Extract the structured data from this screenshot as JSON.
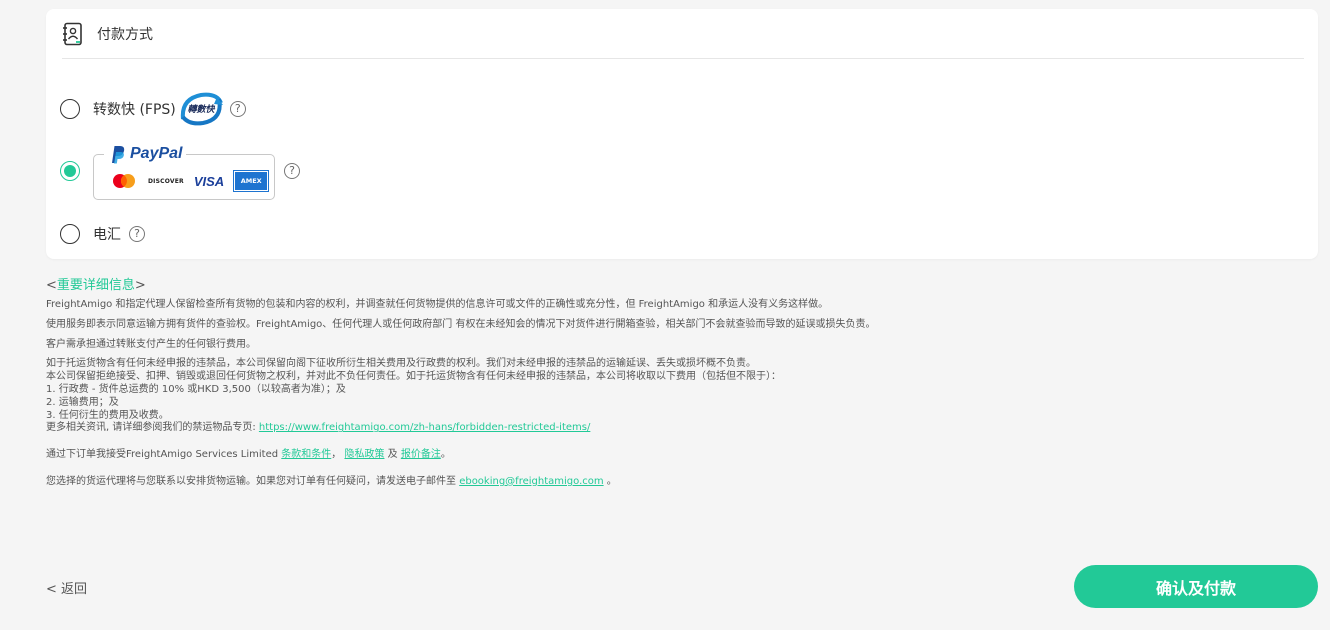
{
  "payment_card": {
    "title": "付款方式",
    "options": [
      {
        "label": "转数快 (FPS)",
        "logo_text": "轉數快",
        "selected": false
      },
      {
        "label": "",
        "brand": "PayPal",
        "card_brands": [
          "DISCOVER",
          "VISA",
          "AMEX"
        ],
        "selected": true
      },
      {
        "label": "电汇",
        "selected": false
      }
    ],
    "help_glyph": "?"
  },
  "info": {
    "heading_open": "<",
    "heading": "重要详细信息",
    "heading_close": ">",
    "p1": "FreightAmigo 和指定代理人保留检查所有货物的包装和内容的权利，并调查就任何货物提供的信息许可或文件的正确性或充分性，但 FreightAmigo 和承运人没有义务这样做。",
    "p2": "使用服务即表示同意运输方拥有货件的查验权。FreightAmigo、任何代理人或任何政府部门 有权在未经知会的情况下对货件进行開箱查验，相关部门不会就查验而导致的延误或损失负责。",
    "p3": "客户需承担通过转账支付产生的任何银行费用。",
    "p4_lines": [
      "如于托运货物含有任何未经申报的违禁品，本公司保留向阁下征收所衍生相关费用及行政费的权利。我们对未经申报的违禁品的运输延误、丢失或损坏概不负责。",
      "本公司保留拒绝接受、扣押、销毁或退回任何货物之权利，并对此不负任何责任。如于托运货物含有任何未经申报的违禁品，本公司将收取以下费用（包括但不限于）：",
      "1. 行政费 - 货件总运费的 10% 或HKD 3,500（以较高者为准）；及",
      "2. 运输费用；及",
      "3. 任何衍生的费用及收费。"
    ],
    "more_prefix": "更多相关资讯, 请详细参阅我们的禁运物品专页: ",
    "more_link": "https://www.freightamigo.com/zh-hans/forbidden-restricted-items/",
    "terms_prefix": "通过下订单我接受FreightAmigo Services Limited ",
    "terms_link": "条款和条件",
    "terms_sep": "，",
    "privacy_link": "隐私政策",
    "and_text": " 及 ",
    "quote_link": "报价备注",
    "terms_end": "。",
    "contact_prefix": "您选择的货运代理将与您联系以安排货物运输。如果您对订单有任何疑问，请发送电子邮件至 ",
    "contact_email": "ebooking@freightamigo.com",
    "contact_end": " 。"
  },
  "footer": {
    "back_label": "< 返回",
    "confirm_label": "确认及付款"
  },
  "colors": {
    "accent": "#22c997",
    "paypal_blue": "#1b4fa0",
    "background": "#f5f5f5"
  }
}
